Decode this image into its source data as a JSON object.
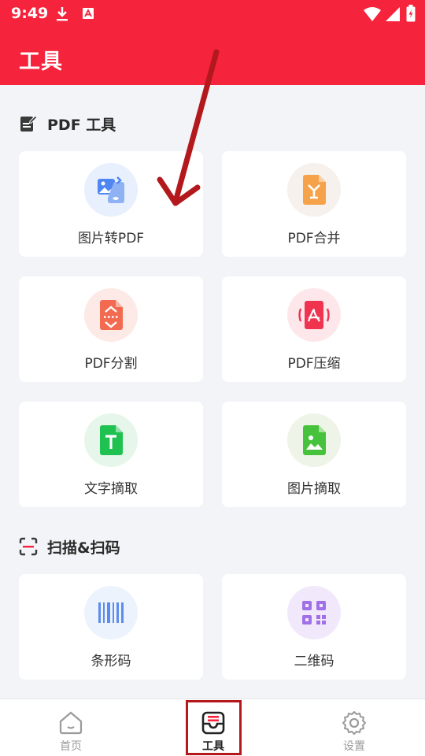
{
  "status_bar": {
    "time": "9:49"
  },
  "header": {
    "title": "工具"
  },
  "sections": {
    "pdf": {
      "title": "PDF 工具"
    },
    "scan": {
      "title": "扫描&扫码"
    }
  },
  "tools": {
    "img_to_pdf": "图片转PDF",
    "pdf_merge": "PDF合并",
    "pdf_split": "PDF分割",
    "pdf_compress": "PDF压缩",
    "text_extract": "文字摘取",
    "image_extract": "图片摘取",
    "barcode": "条形码",
    "qrcode": "二维码"
  },
  "bottom_nav": {
    "home": "首页",
    "tools": "工具",
    "settings": "设置"
  },
  "colors": {
    "accent": "#f5243c",
    "annotation": "#b3181c"
  }
}
